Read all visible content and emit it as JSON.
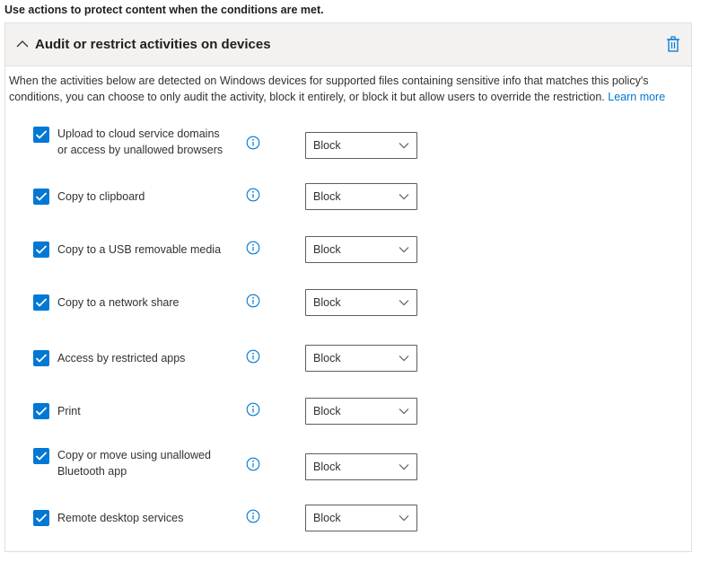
{
  "intro": "Use actions to protect content when the conditions are met.",
  "panel": {
    "title": "Audit or restrict activities on devices",
    "description": "When the activities below are detected on Windows devices for supported files containing sensitive info that matches this policy's conditions, you can choose to only audit the activity, block it entirely, or block it but allow users to override the restriction.",
    "learn_more": "Learn more"
  },
  "activities": [
    {
      "line1": "Upload to cloud service domains",
      "line2": "or access by unallowed browsers",
      "checked": true,
      "action": "Block"
    },
    {
      "line1": "Copy to clipboard",
      "line2": "",
      "checked": true,
      "action": "Block"
    },
    {
      "line1": "Copy to a USB removable media",
      "line2": "",
      "checked": true,
      "action": "Block"
    },
    {
      "line1": "Copy to a network share",
      "line2": "",
      "checked": true,
      "action": "Block"
    },
    {
      "line1": "Access by restricted apps",
      "line2": "",
      "checked": true,
      "action": "Block"
    },
    {
      "line1": "Print",
      "line2": "",
      "checked": true,
      "action": "Block"
    },
    {
      "line1": "Copy or move using unallowed",
      "line2": "Bluetooth app",
      "checked": true,
      "action": "Block"
    },
    {
      "line1": "Remote desktop services",
      "line2": "",
      "checked": true,
      "action": "Block"
    }
  ],
  "icons": {
    "collapse": "chevron-up-icon",
    "delete": "trash-icon",
    "checkbox": "checkmark-icon",
    "info": "info-icon",
    "dropdown": "chevron-down-icon"
  },
  "colors": {
    "accent": "#0078d4",
    "header_bg": "#f3f2f1"
  }
}
